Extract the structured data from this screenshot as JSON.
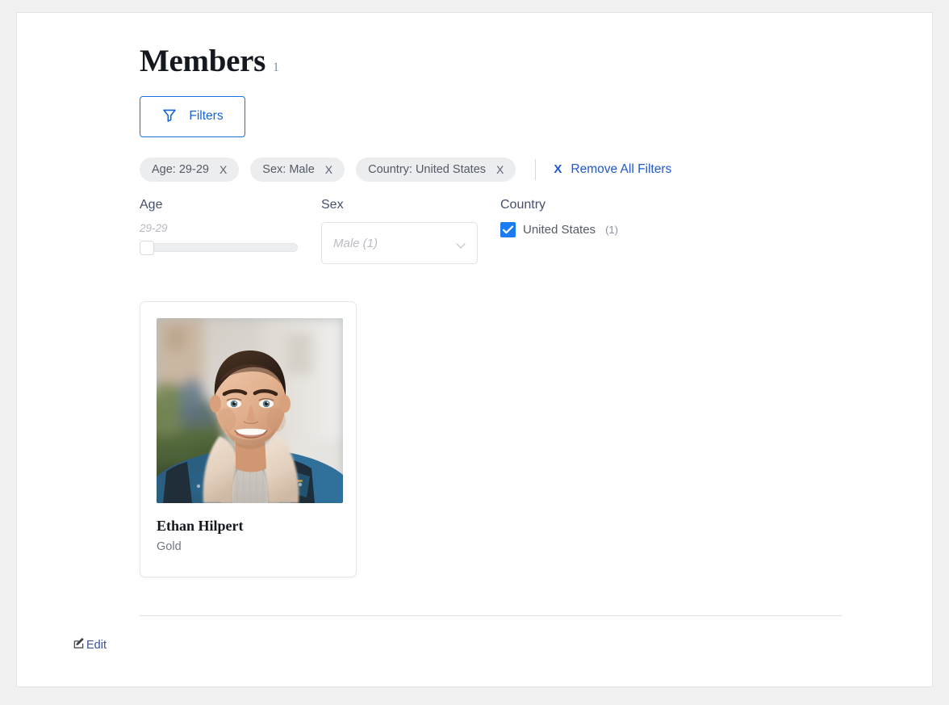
{
  "header": {
    "title": "Members",
    "count": "1"
  },
  "toolbar": {
    "filters_label": "Filters",
    "filters_icon": "funnel-icon"
  },
  "active_filters": {
    "chips": [
      {
        "label": "Age: 29-29",
        "remove": "X"
      },
      {
        "label": "Sex: Male",
        "remove": "X"
      },
      {
        "label": "Country: United States",
        "remove": "X"
      }
    ],
    "remove_all": {
      "icon_label": "X",
      "label": "Remove All Filters"
    }
  },
  "filters": {
    "age": {
      "label": "Age",
      "value": "29-29",
      "min": 29,
      "max": 29,
      "handle_position_pct": 0
    },
    "sex": {
      "label": "Sex",
      "selected": "Male (1)",
      "placeholder": "Male (1)",
      "chevron_icon": "chevron-down-icon"
    },
    "country": {
      "label": "Country",
      "options": [
        {
          "label": "United States",
          "count": "(1)",
          "checked": true
        }
      ]
    }
  },
  "members": [
    {
      "name": "Ethan Hilpert",
      "tier": "Gold",
      "photo_alt": "smiling-man-denim-jacket"
    }
  ],
  "footer": {
    "edit_label": "Edit",
    "edit_icon": "edit-pencil-square-icon"
  },
  "colors": {
    "accent_blue": "#1565d8",
    "link_blue": "#2159c9",
    "checkbox_blue": "#1a7cf0",
    "chip_bg": "#ecedef",
    "page_bg": "#f1f1f1",
    "panel_bg": "#ffffff",
    "text_dark": "#14181f",
    "text_muted": "#6f7680"
  }
}
